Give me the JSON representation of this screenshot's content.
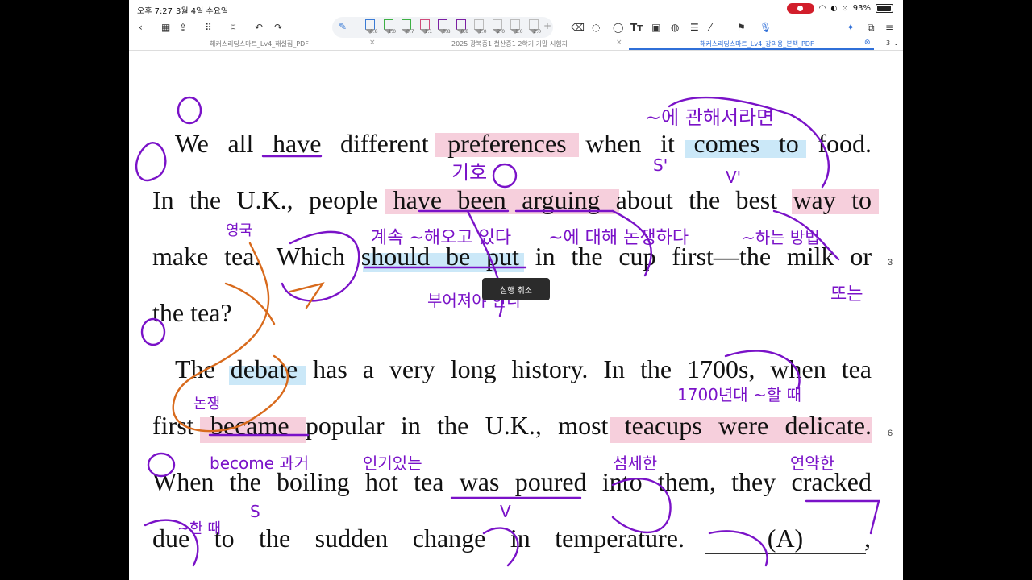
{
  "status_bar": {
    "time": "오후 7:27",
    "date": "3월 4일 수요일",
    "battery": "93%",
    "battery_level": 0.93
  },
  "toolbar": {
    "pen_sizes": [
      "0.8",
      "1.0",
      "0.7",
      "1.1",
      "0.8",
      "0.8",
      "1.0",
      "2.0",
      "1.0",
      "2.0"
    ],
    "pen_colors": [
      "#3a7bd5",
      "#3cb043",
      "#3cb043",
      "#d04a7a",
      "#7b1fa2",
      "#7b1fa2",
      "#bbbbbb",
      "#bbbbbb",
      "#bbbbbb",
      "#bbbbbb"
    ],
    "text_tool": "Tт"
  },
  "tabs": [
    {
      "label": "해커스리딩스마트_Lv4_해설집_PDF",
      "active": false
    },
    {
      "label": "2025 광복중1 철산중1 2학기 기말 시험지",
      "active": false
    },
    {
      "label": "해커스리딩스마트_Lv4_강의용_본책_PDF",
      "active": true
    }
  ],
  "tab_count": "3",
  "document": {
    "lines": [
      "We all have different preferences when it comes to food.",
      "In the U.K., people have been arguing about the best way to",
      "make tea. Which should be put in the cup first—the milk or",
      "the tea?",
      "The debate has a very long history. In the 1700s, when tea",
      "first became popular in the U.K., most teacups were delicate.",
      "When the boiling hot tea was poured into them, they cracked",
      "due to the sudden change in temperature."
    ],
    "blank_label": "(A)",
    "trailing_comma": ",",
    "line_numbers": [
      "3",
      "6"
    ]
  },
  "toast": {
    "label": "실행 취소"
  },
  "annotations": {
    "handwritten": [
      "~에 관해서라면",
      "기호",
      "S'",
      "V'",
      "O",
      "계속 ~해오고 있다",
      "~에 대해 논쟁하다",
      "~하는 방법",
      "또는",
      "영국",
      "S",
      "V",
      "부어져야 한다",
      "논쟁",
      "1700년대 ~할 때",
      "become 과거",
      "인기있는",
      "섬세한",
      "연약한",
      "~한 때"
    ]
  }
}
